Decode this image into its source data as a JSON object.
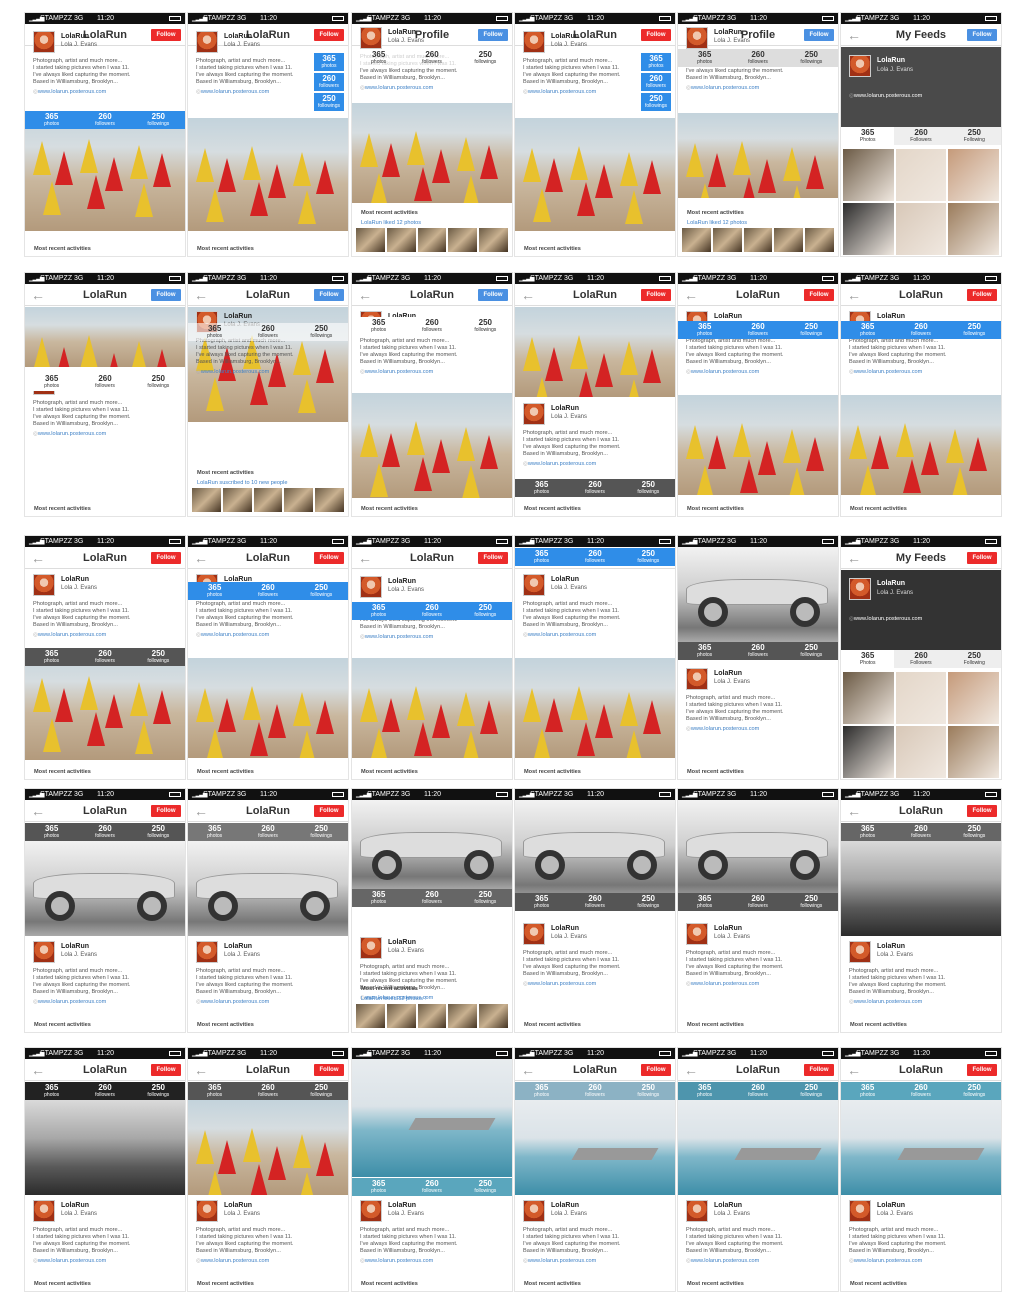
{
  "status": {
    "carrier": "STAMPZZ",
    "network": "3G",
    "time": "11:20"
  },
  "profile": {
    "name": "LolaRun",
    "username": "Lola J. Evans",
    "name_comma": "LolaRun,",
    "bio": [
      "Photograph, artist and much more...",
      "I started taking pictures when I was 11.",
      "I've always liked capturing the moment.",
      "Based in Williamsburg, Brooklyn..."
    ],
    "see_more": "See more bio",
    "url": "www.lolarun.posterous.com"
  },
  "stats": [
    {
      "value": "365",
      "label": "photos"
    },
    {
      "value": "260",
      "label": "followers"
    },
    {
      "value": "250",
      "label": "followings"
    }
  ],
  "stats_cap": [
    {
      "value": "365",
      "label": "Photos"
    },
    {
      "value": "260",
      "label": "Followers"
    },
    {
      "value": "250",
      "label": "Following"
    }
  ],
  "nav": {
    "profile_title": "Profile",
    "feeds_title": "My Feeds",
    "follow_label": "Follow"
  },
  "activities": {
    "heading": "Most recent activities",
    "liked": "LolaRun liked 12 photos",
    "loved": "LolaRun loved 12 photos !",
    "subscribed": "LolaRun suscribed to 10 new people"
  },
  "colors": {
    "follow_red": "#ec2a2a",
    "follow_blue": "#4a90e2",
    "stats_blue": "#2f8de8",
    "stats_gray": "#555555",
    "stats_teal": "#5aa6bd"
  },
  "screens": [
    {
      "title": "LolaRun",
      "btn": "red",
      "img": "sea",
      "imgTop": 98,
      "imgH": 120,
      "statsTop": 98,
      "statsColor": "#2f8de8",
      "profTop": 18,
      "act": "heading"
    },
    {
      "title": "LolaRun",
      "btn": "red",
      "img": "sea",
      "imgTop": 105,
      "imgH": 113,
      "statsSide": true,
      "profTop": 18,
      "act": "heading"
    },
    {
      "title": "Profile",
      "btn": "blue",
      "img": "sea",
      "imgTop": 90,
      "imgH": 100,
      "statsTop": 36,
      "statsColor": "rgba(255,255,255,0.7)",
      "statsText": "#333",
      "profTop": 14,
      "act": "liked"
    },
    {
      "title": "LolaRun",
      "btn": "red",
      "img": "sea",
      "imgTop": 105,
      "imgH": 113,
      "statsSide": true,
      "profTop": 18,
      "act": "heading"
    },
    {
      "title": "Profile",
      "btn": "blue",
      "img": "sea",
      "imgTop": 100,
      "imgH": 85,
      "statsTop": 36,
      "statsColor": "#ddd",
      "statsText": "#333",
      "profTop": 14,
      "act": "liked"
    },
    {
      "title": "My Feeds",
      "btn": "blue",
      "feeds": true
    },
    {
      "title": "LolaRun",
      "btn": "blue",
      "img": "sea",
      "imgTop": 34,
      "imgH": 60,
      "statsTop": 100,
      "statsColor": "#fff",
      "statsText": "#333",
      "profTop": 100,
      "act": "heading"
    },
    {
      "title": "LolaRun",
      "btn": "blue",
      "img": "sea",
      "imgTop": 34,
      "imgH": 115,
      "statsTop": 50,
      "statsColor": "rgba(255,255,255,0.6)",
      "statsText": "#333",
      "profTop": 38,
      "act": "subscribed"
    },
    {
      "title": "LolaRun",
      "btn": "blue",
      "img": "sea",
      "imgTop": 120,
      "imgH": 105,
      "statsTop": 44,
      "statsColor": "#fff",
      "statsText": "#333",
      "profTop": 38,
      "act": "heading"
    },
    {
      "title": "LolaRun",
      "btn": "red",
      "img": "sea",
      "imgTop": 34,
      "imgH": 90,
      "statsTop": 206,
      "statsColor": "#555",
      "profTop": 130,
      "act": "heading"
    },
    {
      "title": "LolaRun",
      "btn": "red",
      "img": "sea",
      "imgTop": 122,
      "imgH": 100,
      "statsTop": 48,
      "statsColor": "#2f8de8",
      "profTop": 38,
      "act": "heading"
    },
    {
      "title": "LolaRun",
      "btn": "red",
      "img": "sea",
      "imgTop": 122,
      "imgH": 100,
      "statsTop": 48,
      "statsColor": "#2f8de8",
      "profTop": 38,
      "act": "heading"
    },
    {
      "title": "LolaRun",
      "btn": "red",
      "img": "sea",
      "imgTop": 112,
      "imgH": 112,
      "statsTop": 112,
      "statsColor": "#555",
      "profTop": 38,
      "act": "heading"
    },
    {
      "title": "LolaRun",
      "btn": "red",
      "img": "sea",
      "imgTop": 122,
      "imgH": 100,
      "statsTop": 46,
      "statsColor": "#2f8de8",
      "profTop": 38,
      "act": "heading"
    },
    {
      "title": "LolaRun",
      "btn": "red",
      "img": "sea",
      "imgTop": 122,
      "imgH": 100,
      "statsTop": 66,
      "statsColor": "#2f8de8",
      "profTop": 40,
      "act": "heading"
    },
    {
      "title": "LolaRun",
      "btn": "red",
      "img": "sea",
      "imgTop": 122,
      "imgH": 100,
      "statsTop": 12,
      "statsColor": "#2f8de8",
      "profTop": 38,
      "act": "heading"
    },
    {
      "title": "LolaRun",
      "btn": "red",
      "img": "car",
      "imgTop": 11,
      "imgH": 95,
      "statsTop": 106,
      "statsColor": "#555",
      "profTop": 132,
      "act": "heading"
    },
    {
      "title": "My Feeds",
      "btn": "red",
      "feeds": true,
      "dark": true
    },
    {
      "title": "LolaRun",
      "btn": "red",
      "img": "car",
      "imgTop": 52,
      "imgH": 95,
      "statsTop": 34,
      "statsColor": "#555",
      "profTop": 152,
      "act": "heading"
    },
    {
      "title": "LolaRun",
      "btn": "red",
      "img": "car",
      "imgTop": 52,
      "imgH": 95,
      "statsTop": 34,
      "statsColor": "#777",
      "profTop": 152,
      "act": "heading"
    },
    {
      "title": "",
      "btn": "red",
      "img": "car",
      "imgTop": 11,
      "imgH": 90,
      "statsTop": 100,
      "statsColor": "#666",
      "profTop": 148,
      "act": "loved"
    },
    {
      "title": "",
      "btn": "red",
      "img": "car",
      "imgTop": 11,
      "imgH": 100,
      "statsTop": 104,
      "statsColor": "#555",
      "profTop": 134,
      "act": "heading"
    },
    {
      "title": "",
      "btn": "red",
      "img": "car",
      "imgTop": 11,
      "imgH": 100,
      "statsTop": 104,
      "statsColor": "#555",
      "profTop": 134,
      "act": "heading"
    },
    {
      "title": "LolaRun",
      "btn": "red",
      "img": "rocks",
      "imgTop": 52,
      "imgH": 95,
      "statsTop": 34,
      "statsColor": "#666",
      "profTop": 152,
      "act": "heading"
    },
    {
      "title": "LolaRun",
      "btn": "red",
      "img": "rocks",
      "imgTop": 52,
      "imgH": 95,
      "statsTop": 34,
      "statsColor": "#222",
      "profTop": 152,
      "act": "heading"
    },
    {
      "title": "LolaRun",
      "btn": "red",
      "img": "sea",
      "imgTop": 52,
      "imgH": 95,
      "statsTop": 34,
      "statsColor": "#555",
      "profTop": 152,
      "act": "heading"
    },
    {
      "title": "LolaRun",
      "btn": "red",
      "img": "lake",
      "imgTop": 11,
      "imgH": 118,
      "statsTop": 130,
      "statsColor": "#5aa6bd",
      "profTop": 152,
      "act": "heading"
    },
    {
      "title": "LolaRun",
      "btn": "red",
      "img": "lake",
      "imgTop": 52,
      "imgH": 95,
      "statsTop": 34,
      "statsColor": "#8cb2c4",
      "profTop": 152,
      "act": "heading"
    },
    {
      "title": "LolaRun",
      "btn": "red",
      "img": "lake",
      "imgTop": 52,
      "imgH": 95,
      "statsTop": 34,
      "statsColor": "#4e95ad",
      "profTop": 152,
      "act": "heading"
    },
    {
      "title": "LolaRun",
      "btn": "red",
      "img": "lake",
      "imgTop": 52,
      "imgH": 95,
      "statsTop": 34,
      "statsColor": "#5aa6bd",
      "profTop": 152,
      "act": "heading"
    }
  ]
}
